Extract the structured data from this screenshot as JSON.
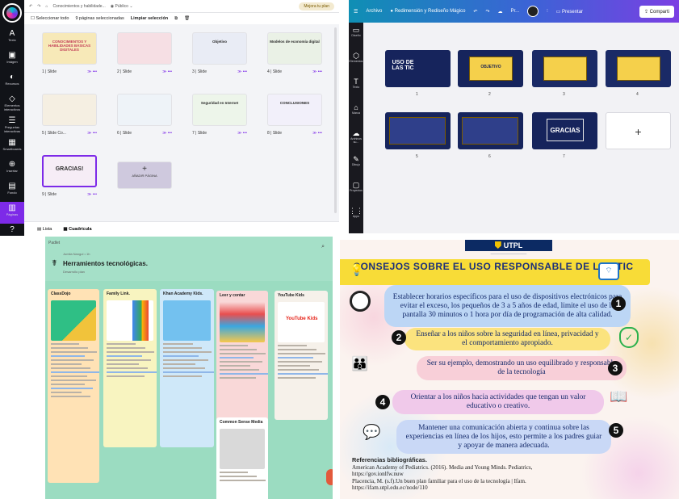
{
  "canva_grid": {
    "topbar": {
      "breadcrumb": "Conocimientos y habilidade...",
      "visibility": "Público",
      "upgrade": "Mejora tu plan"
    },
    "selection": {
      "select_all": "Seleccionar todo",
      "count": "9 páginas seleccionadas",
      "clear": "Limpiar selección"
    },
    "rail": [
      {
        "icon": "text-icon",
        "glyph": "A",
        "label": "Texto"
      },
      {
        "icon": "image-icon",
        "glyph": "▣",
        "label": "Imágen"
      },
      {
        "icon": "resources-icon",
        "glyph": "◐",
        "label": "Recursos"
      },
      {
        "icon": "elements-icon",
        "glyph": "◇",
        "label": "Elementos interactivos"
      },
      {
        "icon": "questions-icon",
        "glyph": "☰",
        "label": "Preguntas interactivas"
      },
      {
        "icon": "smartboards-icon",
        "glyph": "▦",
        "label": "Smartboards"
      },
      {
        "icon": "insert-icon",
        "glyph": "⊕",
        "label": "Insertar"
      },
      {
        "icon": "background-icon",
        "glyph": "▤",
        "label": "Fondo"
      },
      {
        "icon": "pages-icon",
        "glyph": "▥",
        "label": "Páginas"
      },
      {
        "icon": "help-icon",
        "glyph": "?",
        "label": ""
      }
    ],
    "tiles": [
      {
        "label": "1 | Slide",
        "text": "CONOCIMIENTOS Y HABILIDADES BÁSICAS DIGITALES",
        "bg": "#f7e9b8"
      },
      {
        "label": "2 | Slide",
        "text": "",
        "bg": "#f6dfe4"
      },
      {
        "label": "3 | Slide",
        "text": "Objetivo",
        "bg": "#e9ecf5"
      },
      {
        "label": "4 | Slide",
        "text": "Modelos de economía digital",
        "bg": "#eaf1e6"
      },
      {
        "label": "5 | Slide Co...",
        "text": "",
        "bg": "#f5efe2"
      },
      {
        "label": "6 | Slide",
        "text": "",
        "bg": "#eef3f8"
      },
      {
        "label": "7 | Slide",
        "text": "Seguridad en Internet",
        "bg": "#edf5ea"
      },
      {
        "label": "8 | Slide",
        "text": "CONCLUSIONES",
        "bg": "#f2f0fa"
      },
      {
        "label": "9 | Slide",
        "text": "GRACIAS!",
        "bg": "#f6edf6"
      }
    ],
    "add_page": "AÑADIR PÁGINA",
    "footer": {
      "list": "Lista",
      "grid": "Cuadrícula"
    }
  },
  "canva_pres": {
    "top": {
      "menu": "Archivo",
      "resize": "Redimensión y Rediseño Mágico",
      "pr": "Pr...",
      "present": "Presentar",
      "share": "Comparti"
    },
    "side": [
      "Diseño",
      "Elementos",
      "Texto",
      "Marca",
      "Archivos su...",
      "Dibujo",
      "Proyectos",
      "Apps"
    ],
    "slides": [
      {
        "num": "1",
        "text": "USO DE LAS TIC"
      },
      {
        "num": "2",
        "text": "OBJETIVO"
      },
      {
        "num": "3",
        "text": ""
      },
      {
        "num": "4",
        "text": ""
      },
      {
        "num": "5",
        "text": ""
      },
      {
        "num": "6",
        "text": ""
      },
      {
        "num": "7",
        "text": "GRACIAS"
      }
    ]
  },
  "padlet": {
    "app": "Padlet",
    "author": "Jumila Nangul • 1h",
    "title": "Herramientos tecnológicas.",
    "subtitle": "Desarrollo plan",
    "columns": [
      {
        "name": "ClassDojo",
        "bg": "#ffe2b5",
        "img": "#38c18a"
      },
      {
        "name": "Family Link.",
        "bg": "#f8f4c0",
        "img": "#ffffff"
      },
      {
        "name": "Khan Academy Kids.",
        "bg": "#cfe8f9",
        "img": "#73c1ef"
      },
      {
        "name": "Leer y contar",
        "bg": "#f9d8d8",
        "img": "#ffffff"
      },
      {
        "name": "YouTube Kids",
        "bg": "#f6f1ea",
        "img": "#ffffff"
      },
      {
        "name": "Common Sense Media",
        "bg": "#ffffff",
        "img": "#d9d9d9"
      }
    ],
    "yt_text": "YouTube Kids"
  },
  "utpl": {
    "brand": "UTPL",
    "title": "CONSEJOS SOBRE EL USO RESPONSABLE DE LAS TIC",
    "tips": [
      {
        "n": "1",
        "text": "Establecer horarios específicos para el uso de dispositivos electrónicos para evitar el exceso, los pequeños de 3 a 5 años de edad, limite el uso de la pantalla 30 minutos o 1 hora por día de programación de alta calidad.",
        "color": "#bcd6f5"
      },
      {
        "n": "2",
        "text": "Enseñar a los niños sobre la seguridad en línea, privacidad y el comportamiento apropiado.",
        "color": "#fbe37e"
      },
      {
        "n": "3",
        "text": "Ser su ejemplo, demostrando un uso equilibrado y responsable de la tecnología",
        "color": "#f8cfd8"
      },
      {
        "n": "4",
        "text": "Orientar a los niños hacia actividades que tengan un valor educativo o creativo.",
        "color": "#f0c9ea"
      },
      {
        "n": "5",
        "text": "Mantener una comunicación abierta y continua sobre las experiencias en línea de los hijos, esto permite a los padres guiar y apoyar de manera adecuada.",
        "color": "#c9d8f6"
      }
    ],
    "refs_title": "Referencias bibliográficas.",
    "refs": [
      "American Academy of Pediatrics. (2016). Media and Young Minds. Pediatrics,",
      "https://gov.ionlfw.nuw",
      "Placencia, M. (s.f).Un buen plan familiar para el uso de la tecnología | Ifam.",
      "https://ifam.utpl.edu.ec/node/110"
    ]
  }
}
